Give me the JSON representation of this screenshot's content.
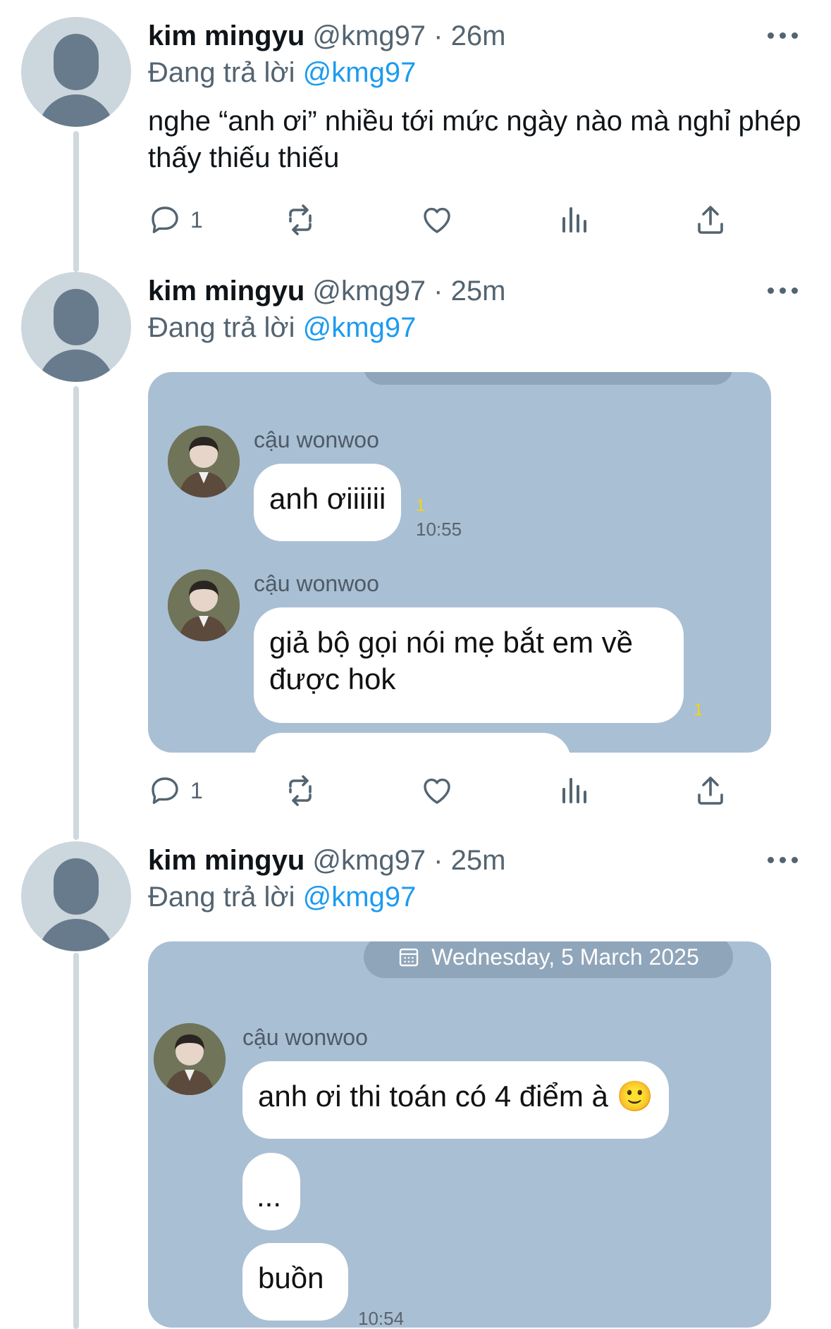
{
  "tweets": [
    {
      "name": "kim mingyu",
      "meta": "@kmg97 · 26m",
      "reply_prefix": "Đang trả lời",
      "reply_handle": "@kmg97",
      "text": "nghe “anh ơi” nhiều tới mức ngày nào mà nghỉ phép thấy thiếu thiếu",
      "reply_count": "1"
    },
    {
      "name": "kim mingyu",
      "meta": "@kmg97 · 25m",
      "reply_prefix": "Đang trả lời",
      "reply_handle": "@kmg97",
      "reply_count": "1",
      "chat": {
        "messages": [
          {
            "sender": "cậu wonwoo",
            "text": "anh ơiiiiii",
            "read": "1",
            "time": "10:55"
          },
          {
            "sender": "cậu wonwoo",
            "text": "giả bộ gọi nói mẹ bắt em về được hok",
            "read": "1"
          }
        ]
      }
    },
    {
      "name": "kim mingyu",
      "meta": "@kmg97 · 25m",
      "reply_prefix": "Đang trả lời",
      "reply_handle": "@kmg97",
      "chat": {
        "date": "Wednesday, 5 March 2025",
        "sender": "cậu wonwoo",
        "messages": [
          "anh ơi thi toán có 4 điểm à 🙂",
          "...",
          "buồn"
        ],
        "time": "10:54"
      }
    }
  ],
  "icons": {
    "reply": "reply-icon",
    "retweet": "retweet-icon",
    "like": "heart-icon",
    "views": "views-icon",
    "share": "share-icon",
    "more": "more-icon",
    "calendar": "calendar-icon"
  },
  "colors": {
    "link": "#1d9bf0",
    "secondary": "#536471",
    "chat_background": "#a9bfd4",
    "read_receipt": "#f2d60f"
  }
}
